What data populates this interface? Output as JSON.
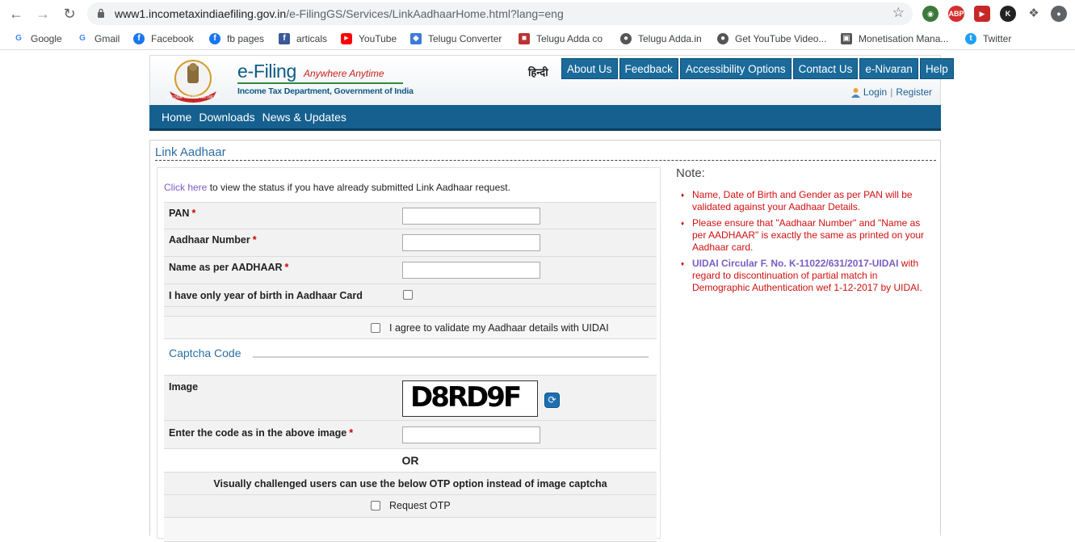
{
  "browser": {
    "url_host": "www1.incometaxindiaefiling.gov.in",
    "url_path": "/e-FilingGS/Services/LinkAadhaarHome.html?lang=eng",
    "extensions": [
      "ABP",
      "K"
    ],
    "bookmarks": [
      {
        "label": "Google",
        "icon": "G",
        "color": "#4285f4"
      },
      {
        "label": "Gmail",
        "icon": "G",
        "color": "#4285f4"
      },
      {
        "label": "Facebook",
        "icon": "f",
        "color": "#1877f2"
      },
      {
        "label": "fb pages",
        "icon": "f",
        "color": "#1877f2"
      },
      {
        "label": "articals",
        "icon": "f",
        "color": "#3b5998"
      },
      {
        "label": "YouTube",
        "icon": "▶",
        "color": "#ff0000"
      },
      {
        "label": "Telugu Converter",
        "icon": "◆",
        "color": "#3d7bd9"
      },
      {
        "label": "Telugu Adda co",
        "icon": "■",
        "color": "#b33"
      },
      {
        "label": "Telugu Adda.in",
        "icon": "●",
        "color": "#555"
      },
      {
        "label": "Get YouTube Video...",
        "icon": "●",
        "color": "#555"
      },
      {
        "label": "Monetisation Mana...",
        "icon": "▣",
        "color": "#555"
      },
      {
        "label": "Twitter",
        "icon": "t",
        "color": "#1da1f2"
      }
    ]
  },
  "header": {
    "logo_title": "e-Filing",
    "logo_tagline": "Anywhere Anytime",
    "logo_subtitle": "Income Tax Department, Government of India",
    "hindi_link": "हिन्दी",
    "top_nav": [
      "About Us",
      "Feedback",
      "Accessibility Options",
      "Contact Us",
      "e-Nivaran",
      "Help"
    ],
    "login": "Login",
    "register": "Register"
  },
  "main_nav": [
    "Home",
    "Downloads",
    "News & Updates"
  ],
  "page": {
    "title": "Link Aadhaar",
    "status_link": "Click here",
    "status_text": " to view the status if you have already submitted Link Aadhaar request."
  },
  "form": {
    "pan_label": "PAN",
    "aadhaar_label": "Aadhaar Number",
    "name_label": "Name as per AADHAAR",
    "yob_label": "I have only year of birth in Aadhaar Card",
    "agree_label": "I agree to validate my Aadhaar details with UIDAI",
    "required_mark": "*",
    "pan_value": "",
    "aadhaar_value": "",
    "name_value": ""
  },
  "captcha": {
    "heading": "Captcha Code",
    "image_label": "Image",
    "image_text": "D8RD9F",
    "code_label": "Enter the code as in the above image",
    "or_text": "OR",
    "otp_notice": "Visually challenged users can use the below OTP option instead of image captcha",
    "otp_label": "Request OTP"
  },
  "notes": {
    "title": "Note:",
    "item1": "Name, Date of Birth and Gender as per PAN will be validated against your Aadhaar Details.",
    "item2": "Please ensure that \"Aadhaar Number\" and \"Name as per AADHAAR\" is exactly the same as printed on your Aadhaar card.",
    "item3_link": "UIDAI Circular F. No. K-11022/631/2017-UIDAI",
    "item3_text": " with regard to discontinuation of partial match in Demographic Authentication wef 1-12-2017 by UIDAI."
  }
}
